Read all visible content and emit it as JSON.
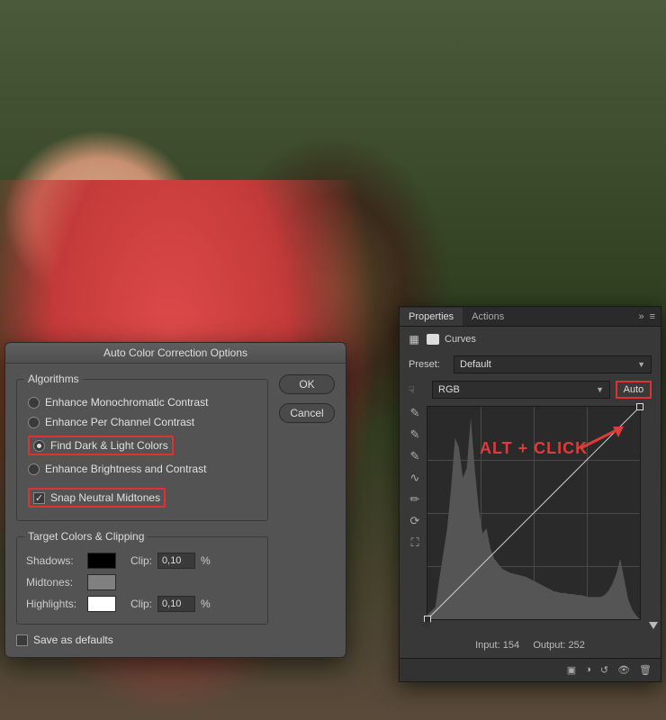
{
  "acc": {
    "title": "Auto Color Correction Options",
    "algorithms_label": "Algorithms",
    "options": [
      {
        "label": "Enhance Monochromatic Contrast",
        "selected": false
      },
      {
        "label": "Enhance Per Channel Contrast",
        "selected": false
      },
      {
        "label": "Find Dark & Light Colors",
        "selected": true
      },
      {
        "label": "Enhance Brightness and Contrast",
        "selected": false
      }
    ],
    "snap_label": "Snap Neutral Midtones",
    "snap_checked": true,
    "ok_label": "OK",
    "cancel_label": "Cancel",
    "target_label": "Target Colors & Clipping",
    "shadows_label": "Shadows:",
    "midtones_label": "Midtones:",
    "highlights_label": "Highlights:",
    "clip_label": "Clip:",
    "shadows_clip": "0,10",
    "highlights_clip": "0,10",
    "pct": "%",
    "swatches": {
      "shadows": "#000000",
      "midtones": "#808080",
      "highlights": "#ffffff"
    },
    "save_defaults_label": "Save as defaults",
    "save_defaults_checked": false
  },
  "props": {
    "tabs": [
      "Properties",
      "Actions"
    ],
    "active_tab": 0,
    "panel_title": "Curves",
    "preset_label": "Preset:",
    "preset_value": "Default",
    "channel_value": "RGB",
    "auto_label": "Auto",
    "annotation": "ALT + CLICK",
    "input_label": "Input:",
    "output_label": "Output:",
    "input_value": 154,
    "output_value": 252,
    "footer_icons": [
      "clip-layer-icon",
      "prev-state-icon",
      "reset-icon",
      "visibility-icon",
      "delete-icon"
    ]
  },
  "chart_data": {
    "type": "line",
    "title": "Curves",
    "xlabel": "Input",
    "ylabel": "Output",
    "xlim": [
      0,
      255
    ],
    "ylim": [
      0,
      255
    ],
    "series": [
      {
        "name": "curve",
        "x": [
          0,
          255
        ],
        "y": [
          0,
          255
        ]
      }
    ],
    "histogram": [
      5,
      8,
      12,
      40,
      65,
      90,
      130,
      180,
      170,
      140,
      150,
      200,
      150,
      110,
      85,
      90,
      70,
      60,
      55,
      50,
      48,
      46,
      45,
      44,
      43,
      42,
      40,
      38,
      36,
      34,
      32,
      30,
      28,
      27,
      26,
      26,
      25,
      25,
      24,
      24,
      23,
      22,
      22,
      22,
      22,
      24,
      28,
      35,
      45,
      60,
      40,
      20,
      10,
      4
    ],
    "sample_point": {
      "input": 154,
      "output": 252
    }
  }
}
